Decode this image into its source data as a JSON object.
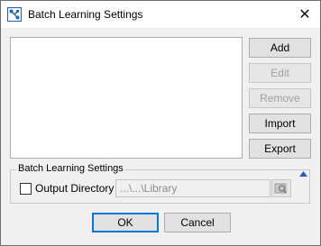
{
  "window": {
    "title": "Batch Learning Settings",
    "close_glyph": "✕"
  },
  "buttons": {
    "add": "Add",
    "edit": "Edit",
    "remove": "Remove",
    "import": "Import",
    "export": "Export"
  },
  "group": {
    "label": "Batch Learning Settings",
    "output_directory_label": "Output Directory",
    "output_directory_checked": false,
    "output_directory_value": "...\\...\\Library"
  },
  "dialog": {
    "ok": "OK",
    "cancel": "Cancel"
  },
  "colors": {
    "focus": "#0078d7",
    "disabled_text": "#a0a0a0",
    "accent_icon": "#1f5fbf"
  }
}
